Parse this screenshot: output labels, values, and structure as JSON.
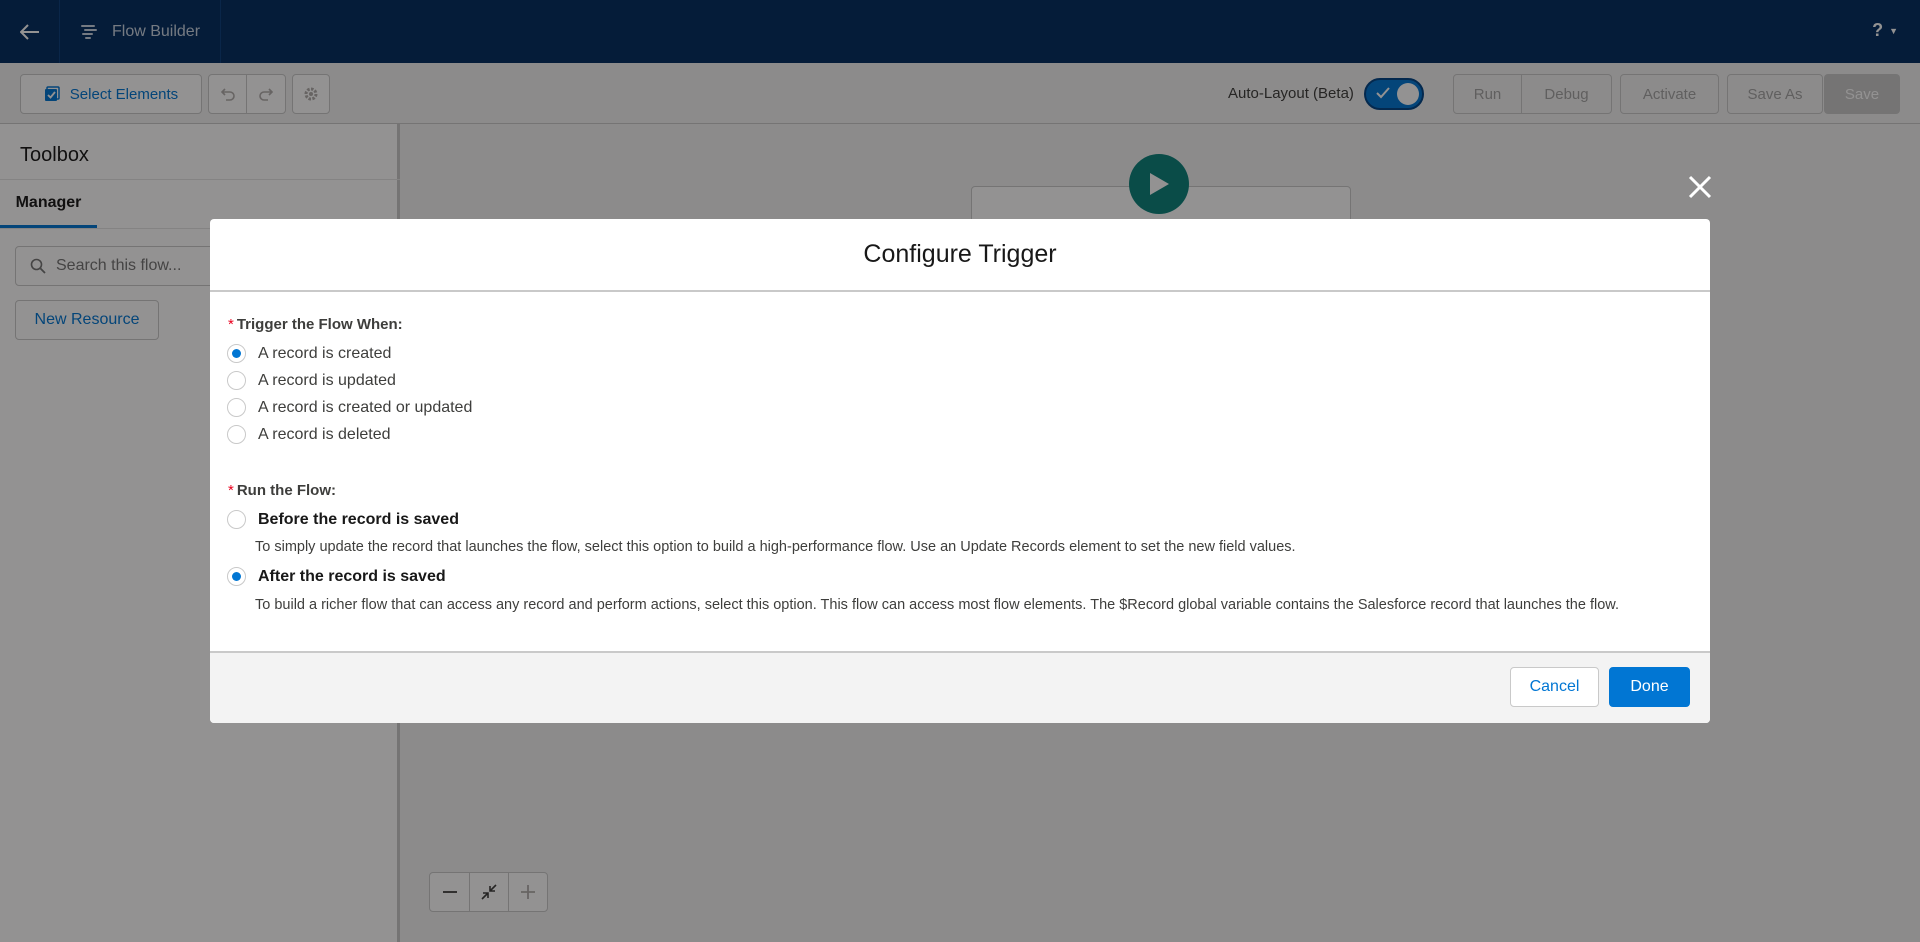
{
  "header": {
    "app_title": "Flow Builder",
    "help_label": "?"
  },
  "toolbar": {
    "select_elements_label": "Select Elements",
    "auto_layout_label": "Auto-Layout (Beta)",
    "auto_layout_on": true,
    "run_label": "Run",
    "debug_label": "Debug",
    "activate_label": "Activate",
    "save_as_label": "Save As",
    "save_label": "Save"
  },
  "toolbox": {
    "title": "Toolbox",
    "active_tab": "Manager",
    "search_placeholder": "Search this flow...",
    "new_resource_label": "New Resource"
  },
  "modal": {
    "title": "Configure Trigger",
    "trigger_label": "Trigger the Flow When:",
    "trigger_options": [
      {
        "label": "A record is created",
        "checked": true
      },
      {
        "label": "A record is updated",
        "checked": false
      },
      {
        "label": "A record is created or updated",
        "checked": false
      },
      {
        "label": "A record is deleted",
        "checked": false
      }
    ],
    "run_label": "Run the Flow:",
    "run_options": [
      {
        "label": "Before the record is saved",
        "checked": false,
        "help": "To simply update the record that launches the flow, select this option to build a high-performance flow. Use an Update Records element to set the new field values."
      },
      {
        "label": "After the record is saved",
        "checked": true,
        "help": "To build a richer flow that can access any record and perform actions, select this option. This flow can access most flow elements. The $Record global variable contains the Salesforce record that launches the flow."
      }
    ],
    "required_marker": "*",
    "cancel_label": "Cancel",
    "done_label": "Done"
  },
  "colors": {
    "header_bg": "#032d60",
    "brand_blue": "#0176d3",
    "start_node": "#0b827c",
    "required": "#ea001e"
  }
}
